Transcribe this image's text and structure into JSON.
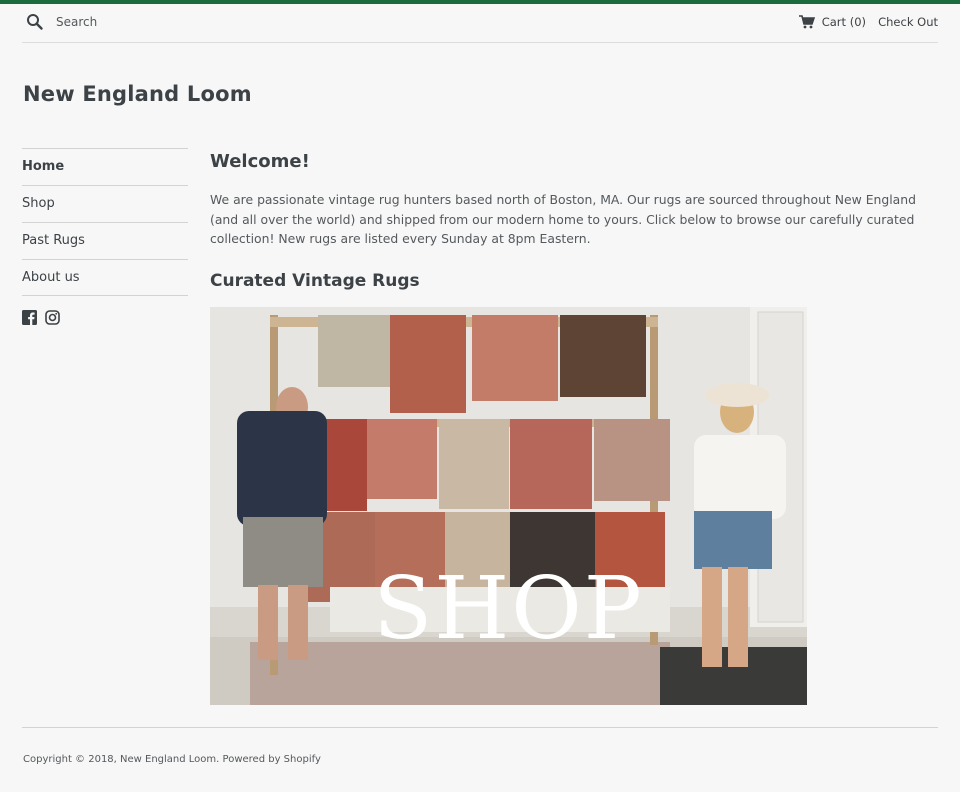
{
  "header": {
    "search": {
      "placeholder": "Search"
    },
    "cart_label": "Cart (0)",
    "checkout_label": "Check Out"
  },
  "site": {
    "title": "New England Loom"
  },
  "nav": {
    "items": [
      {
        "label": "Home",
        "active": true
      },
      {
        "label": "Shop"
      },
      {
        "label": "Past Rugs"
      },
      {
        "label": "About us"
      }
    ],
    "social": [
      "facebook-icon",
      "instagram-icon"
    ]
  },
  "main": {
    "welcome_heading": "Welcome!",
    "intro": "We are passionate vintage rug hunters based north of Boston, MA. Our rugs are sourced throughout New England (and all over the world) and shipped from our modern home to yours. Click below to browse our carefully curated collection! New rugs are listed every Sunday at 8pm Eastern.",
    "curated_heading": "Curated Vintage Rugs",
    "hero_text": "SHOP"
  },
  "footer": {
    "copyright": "Copyright © 2018, New England Loom.",
    "powered": "Powered by Shopify"
  },
  "colors": {
    "accent_bar": "#1c6b3f",
    "text": "#3d4246",
    "background": "#f7f7f7"
  }
}
